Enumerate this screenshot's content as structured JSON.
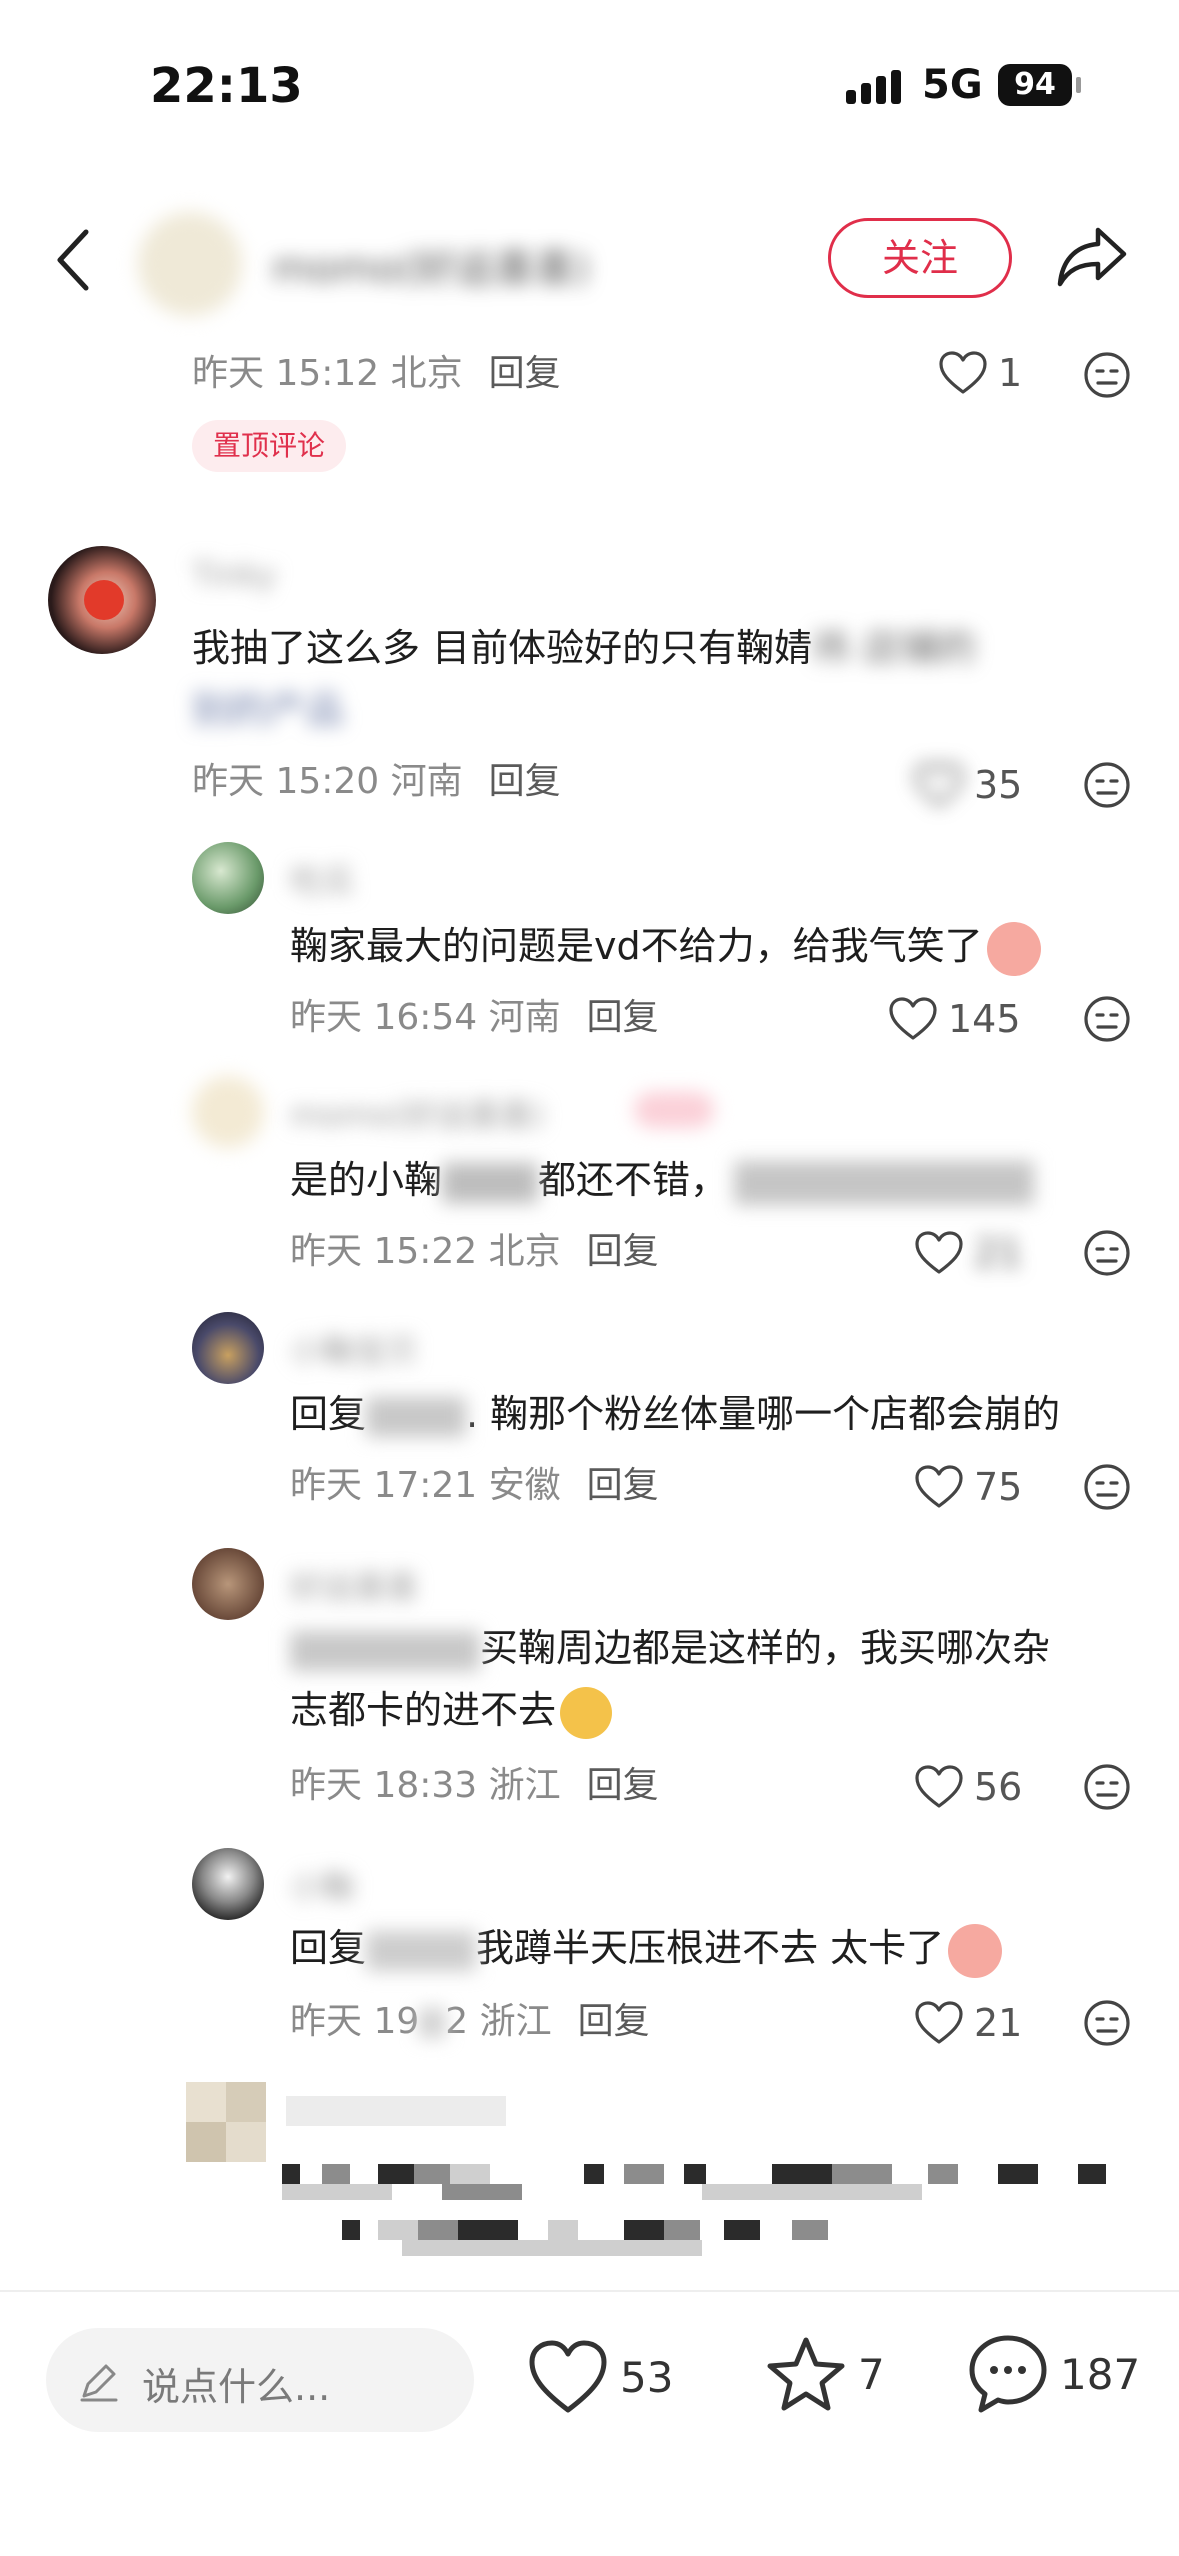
{
  "status_bar": {
    "time": "22:13",
    "network": "5G",
    "battery": "94"
  },
  "header": {
    "author": "momo(好运喜喜)",
    "follow_label": "关注"
  },
  "pinned": {
    "time": "昨天 15:12 北京",
    "reply": "回复",
    "likes": "1",
    "tag": "置顶评论"
  },
  "comments": [
    {
      "name": "Tinky",
      "text_line1_a": "我抽了这么多 目前体验好的只有鞠婧",
      "text_line1_b": "祎 店铺的",
      "text_line2": "别的产品",
      "meta": "昨天 15:20 河南",
      "reply": "回复",
      "likes": "35"
    },
    {
      "name": "吃瓜",
      "text": "鞠家最大的问题是vd不给力，给我气笑了",
      "meta": "昨天 16:54 河南",
      "reply": "回复",
      "likes": "145"
    },
    {
      "name": "momo(好运喜喜)",
      "text_a": "是的小鞠",
      "text_b": "都还不错，",
      "meta": "昨天 15:22 北京",
      "reply": "回复",
      "likes": "21"
    },
    {
      "name": "小鞠宝贝",
      "text_a": "回复",
      "text_b": ". 鞠那个粉丝体量哪一个店都会崩的",
      "meta": "昨天 17:21 安徽",
      "reply": "回复",
      "likes": "75"
    },
    {
      "name": "好运喜喜",
      "text_line1": "买鞠周边都是这样的，我买哪次杂",
      "text_line2": "志都卡的进不去",
      "meta": "昨天 18:33 浙江",
      "reply": "回复",
      "likes": "56"
    },
    {
      "name": "小鞠",
      "text_a": "回复",
      "text_b": "我蹲半天压根进不去 太卡了",
      "meta_a": "昨天 19",
      "meta_b": "2 浙江",
      "reply": "回复",
      "likes": "21"
    }
  ],
  "bottom_bar": {
    "placeholder": "说点什么...",
    "likes": "53",
    "stars": "7",
    "comments": "187"
  }
}
